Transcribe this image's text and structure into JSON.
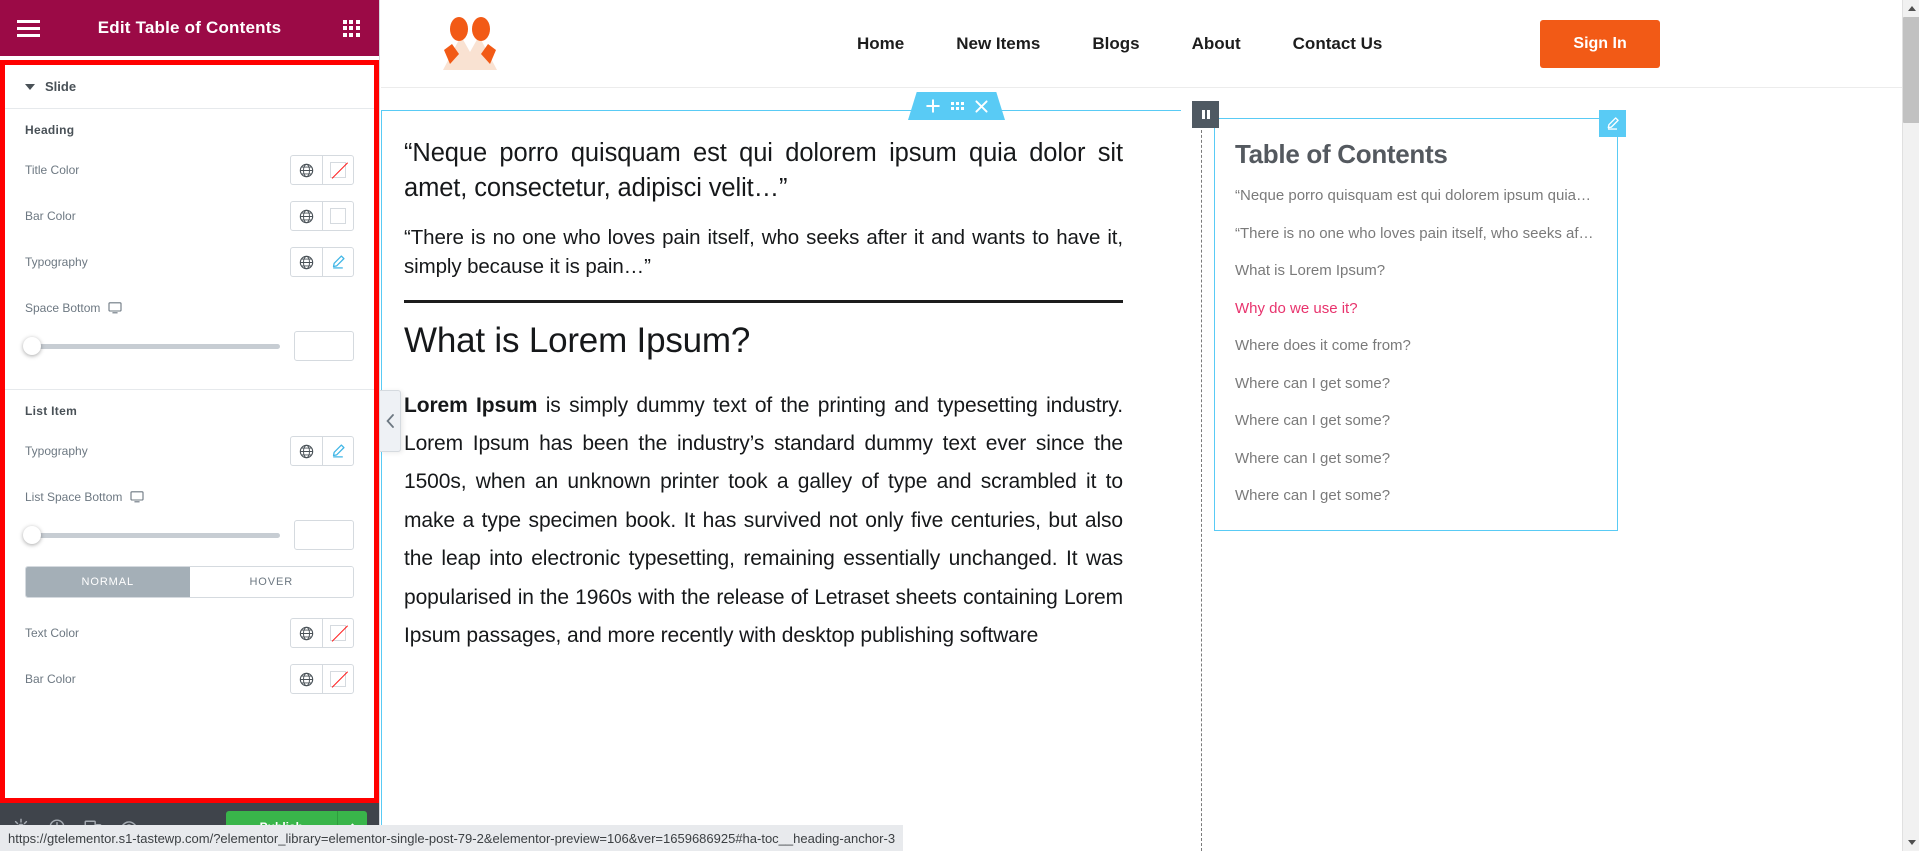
{
  "panel": {
    "title": "Edit Table of Contents",
    "menu_icon": "hamburger-icon",
    "grid_icon": "grid-icon",
    "section": {
      "label": "Slide",
      "caret": "caret-down-icon"
    },
    "heading_group": {
      "title": "Heading",
      "rows": [
        {
          "label": "Title Color",
          "globe": "globe-icon",
          "control": "color-swatch-empty"
        },
        {
          "label": "Bar Color",
          "globe": "globe-icon",
          "control": "color-swatch-blank"
        },
        {
          "label": "Typography",
          "globe": "globe-icon",
          "control": "pencil-icon"
        }
      ],
      "space_bottom": {
        "label": "Space Bottom",
        "device_icon": "desktop-icon",
        "value": ""
      }
    },
    "list_group": {
      "title": "List Item",
      "typography": {
        "label": "Typography",
        "globe": "globe-icon",
        "control": "pencil-icon"
      },
      "list_space_bottom": {
        "label": "List Space Bottom",
        "device_icon": "desktop-icon",
        "value": ""
      },
      "tabs": [
        {
          "label": "NORMAL",
          "active": true
        },
        {
          "label": "HOVER",
          "active": false
        }
      ],
      "rows": [
        {
          "label": "Text Color",
          "globe": "globe-icon",
          "control": "color-swatch-empty"
        },
        {
          "label": "Bar Color",
          "globe": "globe-icon",
          "control": "color-swatch-empty"
        }
      ]
    },
    "footer": {
      "icons": [
        "settings-gear-icon",
        "history-icon",
        "responsive-icon",
        "preview-icon"
      ],
      "publish_label": "Publish",
      "publish_caret": "caret-up-icon"
    },
    "collapse_handle_icon": "chevron-left-icon"
  },
  "colors": {
    "panel_header_bg": "#9b0a46",
    "highlight_border": "#ff0000",
    "elementor_blue": "#59cbf5",
    "publish_green": "#39b54a",
    "brand_orange": "#f25a16",
    "toc_active": "#e8336d"
  },
  "site": {
    "logo_icon": "three-dots-chevron-logo",
    "nav": [
      {
        "label": "Home"
      },
      {
        "label": "New Items"
      },
      {
        "label": "Blogs"
      },
      {
        "label": "About"
      },
      {
        "label": "Contact Us"
      }
    ],
    "signin_label": "Sign In"
  },
  "section_tab": {
    "add_icon": "plus-icon",
    "drag_icon": "grid-dots-icon",
    "close_icon": "close-icon"
  },
  "post": {
    "quote1": "“Neque porro quisquam est qui dolorem ipsum quia dolor sit amet, consectetur, adipisci velit…”",
    "quote2": "“There is no one who loves pain itself, who seeks after it and wants to have it, simply because it is pain…”",
    "heading": "What is Lorem Ipsum?",
    "paragraph_bold": "Lorem Ipsum",
    "paragraph_rest": " is simply dummy text of the printing and typesetting industry. Lorem Ipsum has been the industry’s standard dummy text ever since the 1500s, when an unknown printer took a galley of type and scrambled it to make a type specimen book. It has survived not only five centuries, but also the leap into electronic typesetting, remaining essentially unchanged. It was popularised in the 1960s with the release of Letraset sheets containing Lorem Ipsum passages, and more recently with desktop publishing software"
  },
  "toc": {
    "title": "Table of Contents",
    "edit_icon": "pencil-icon",
    "handle_icon": "widget-handle-icon",
    "items": [
      {
        "label": "“Neque porro quisquam est qui dolorem ipsum quia dol…",
        "active": false
      },
      {
        "label": "“There is no one who loves pain itself, who seeks after it …",
        "active": false
      },
      {
        "label": "What is Lorem Ipsum?",
        "active": false
      },
      {
        "label": "Why do we use it?",
        "active": true
      },
      {
        "label": "Where does it come from?",
        "active": false
      },
      {
        "label": "Where can I get some?",
        "active": false
      },
      {
        "label": "Where can I get some?",
        "active": false
      },
      {
        "label": "Where can I get some?",
        "active": false
      },
      {
        "label": "Where can I get some?",
        "active": false
      }
    ]
  },
  "statusbar": {
    "url": "https://gtelementor.s1-tastewp.com/?elementor_library=elementor-single-post-79-2&elementor-preview=106&ver=1659686925#ha-toc__heading-anchor-3"
  },
  "scrollbar": {
    "up_icon": "scroll-up-arrow",
    "down_icon": "scroll-down-arrow",
    "thumb": "scroll-thumb"
  }
}
